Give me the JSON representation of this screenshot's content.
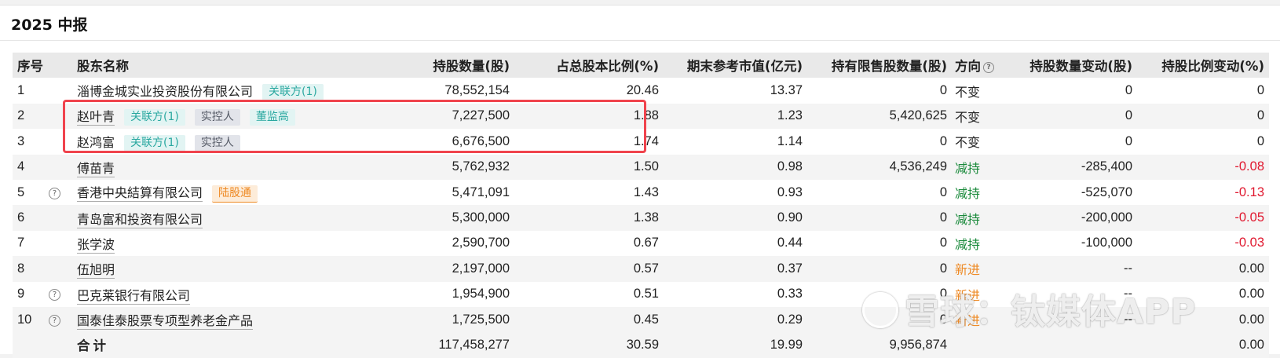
{
  "section_title": "2025 中报",
  "headers": {
    "idx": "序号",
    "name": "股东名称",
    "shares": "持股数量(股)",
    "pct": "占总股本比例(%)",
    "mv": "期末参考市值(亿元)",
    "restricted": "持有限售股数量(股)",
    "direction": "方向",
    "share_change": "持股数量变动(股)",
    "pct_change": "持股比例变动(%)"
  },
  "rows": [
    {
      "idx": "1",
      "help": false,
      "name": "淄博金城实业投资股份有限公司",
      "tags": [
        {
          "text": "关联方(1)",
          "style": "teal"
        }
      ],
      "shares": "78,552,154",
      "pct": "20.46",
      "mv": "13.37",
      "restricted": "0",
      "direction": "不变",
      "dir_style": "same",
      "share_change": "0",
      "pct_change": "0",
      "pct_change_style": "plain"
    },
    {
      "idx": "2",
      "help": false,
      "name": "赵叶青",
      "tags": [
        {
          "text": "关联方(1)",
          "style": "teal"
        },
        {
          "text": "实控人",
          "style": "gray"
        },
        {
          "text": "董监高",
          "style": "teal"
        }
      ],
      "shares": "7,227,500",
      "pct": "1.88",
      "mv": "1.23",
      "restricted": "5,420,625",
      "direction": "不变",
      "dir_style": "same",
      "share_change": "0",
      "pct_change": "0",
      "pct_change_style": "plain"
    },
    {
      "idx": "3",
      "help": false,
      "name": "赵鸿富",
      "tags": [
        {
          "text": "关联方(1)",
          "style": "teal"
        },
        {
          "text": "实控人",
          "style": "gray"
        }
      ],
      "shares": "6,676,500",
      "pct": "1.74",
      "mv": "1.14",
      "restricted": "0",
      "direction": "不变",
      "dir_style": "same",
      "share_change": "0",
      "pct_change": "0",
      "pct_change_style": "plain"
    },
    {
      "idx": "4",
      "help": false,
      "name": "傅苗青",
      "tags": [],
      "shares": "5,762,932",
      "pct": "1.50",
      "mv": "0.98",
      "restricted": "4,536,249",
      "direction": "减持",
      "dir_style": "down",
      "share_change": "-285,400",
      "pct_change": "-0.08",
      "pct_change_style": "neg"
    },
    {
      "idx": "5",
      "help": true,
      "name": "香港中央結算有限公司",
      "tags": [
        {
          "text": "陆股通",
          "style": "orange"
        }
      ],
      "shares": "5,471,091",
      "pct": "1.43",
      "mv": "0.93",
      "restricted": "0",
      "direction": "减持",
      "dir_style": "down",
      "share_change": "-525,070",
      "pct_change": "-0.13",
      "pct_change_style": "neg"
    },
    {
      "idx": "6",
      "help": false,
      "name": "青岛富和投资有限公司",
      "tags": [],
      "shares": "5,300,000",
      "pct": "1.38",
      "mv": "0.90",
      "restricted": "0",
      "direction": "减持",
      "dir_style": "down",
      "share_change": "-200,000",
      "pct_change": "-0.05",
      "pct_change_style": "neg"
    },
    {
      "idx": "7",
      "help": false,
      "name": "张学波",
      "tags": [],
      "shares": "2,590,700",
      "pct": "0.67",
      "mv": "0.44",
      "restricted": "0",
      "direction": "减持",
      "dir_style": "down",
      "share_change": "-100,000",
      "pct_change": "-0.03",
      "pct_change_style": "neg"
    },
    {
      "idx": "8",
      "help": false,
      "name": "伍旭明",
      "tags": [],
      "shares": "2,197,000",
      "pct": "0.57",
      "mv": "0.37",
      "restricted": "0",
      "direction": "新进",
      "dir_style": "new",
      "share_change": "--",
      "pct_change": "0.00",
      "pct_change_style": "plain"
    },
    {
      "idx": "9",
      "help": true,
      "name": "巴克莱银行有限公司",
      "tags": [],
      "shares": "1,954,900",
      "pct": "0.51",
      "mv": "0.33",
      "restricted": "0",
      "direction": "新进",
      "dir_style": "new",
      "share_change": "--",
      "pct_change": "0.00",
      "pct_change_style": "plain"
    },
    {
      "idx": "10",
      "help": true,
      "name": "国泰佳泰股票专项型养老金产品",
      "tags": [],
      "shares": "1,725,500",
      "pct": "0.45",
      "mv": "0.29",
      "restricted": "0",
      "direction": "新进",
      "dir_style": "new",
      "share_change": "--",
      "pct_change": "0.00",
      "pct_change_style": "plain"
    }
  ],
  "total": {
    "label": "合计",
    "shares": "117,458,277",
    "pct": "30.59",
    "mv": "19.99",
    "restricted": "9,956,874",
    "pct_change": "0.00"
  },
  "help_glyph": "?",
  "watermark": "雪球：钛媒体APP",
  "colors": {
    "highlight_border": "#f0434d",
    "decrease": "#1a8a3b",
    "new": "#ee8a25",
    "negative": "#e0172e",
    "tag_teal": "#2aa8a0",
    "tag_orange": "#ee8a25"
  }
}
